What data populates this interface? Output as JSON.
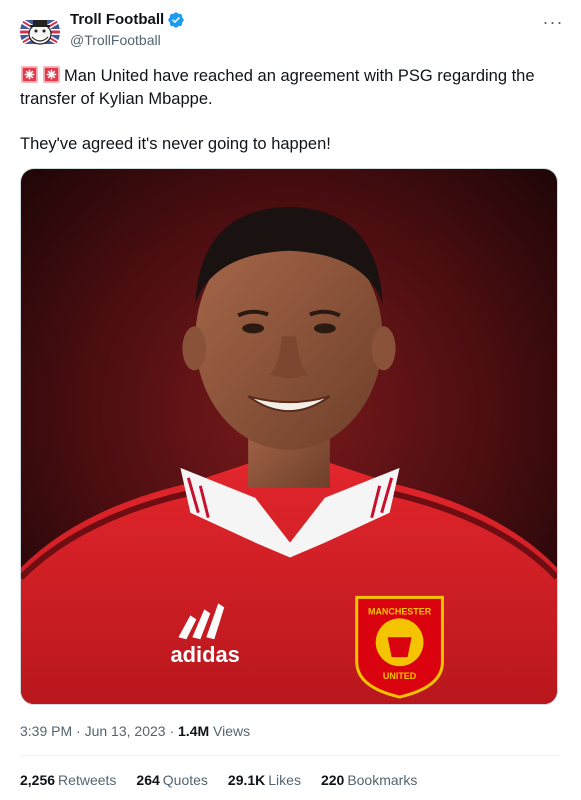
{
  "author": {
    "display_name": "Troll Football",
    "handle": "@TrollFootball",
    "avatar_icon": "troll-face-union-jack-avatar",
    "verified_icon": "verified-badge-icon",
    "verified_color": "#1d9bf0"
  },
  "more_label": "···",
  "tweet": {
    "emoji_icon": "siren-icon",
    "line1": "Man United have reached an agreement with PSG regarding the transfer of Kylian Mbappe.",
    "line2": "They've agreed it's never going to happen!"
  },
  "media": {
    "kit_brand": "adidas",
    "crest_top": "MANCHESTER",
    "crest_bottom": "UNITED",
    "background_color": "#3a0a0c",
    "kit_color": "#d21f26"
  },
  "meta": {
    "time": "3:39 PM",
    "separator": " · ",
    "date": "Jun 13, 2023",
    "views_count": "1.4M",
    "views_label": " Views"
  },
  "stats": [
    {
      "count": "2,256",
      "label": "Retweets"
    },
    {
      "count": "264",
      "label": "Quotes"
    },
    {
      "count": "29.1K",
      "label": "Likes"
    },
    {
      "count": "220",
      "label": "Bookmarks"
    }
  ]
}
